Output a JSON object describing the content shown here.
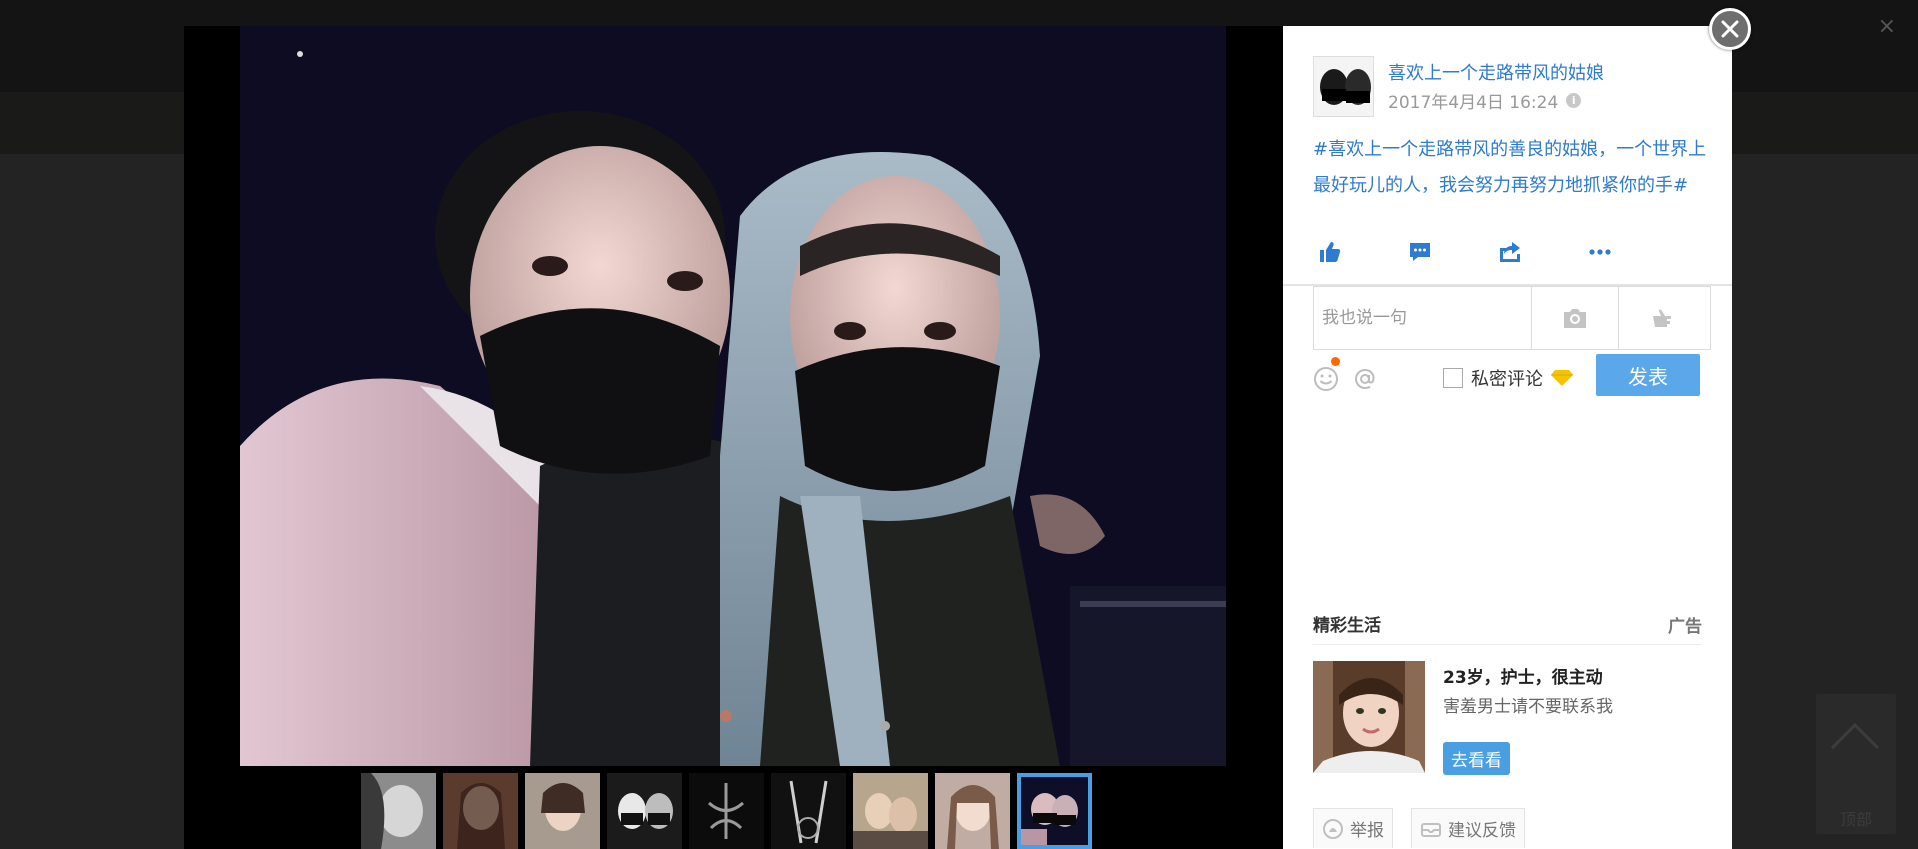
{
  "background": {
    "back_to_top_label": "顶部"
  },
  "post": {
    "author": "喜欢上一个走路带风的姑娘",
    "time": "2017年4月4日 16:24",
    "text": "#喜欢上一个走路带风的善良的姑娘，一个世界上最好玩儿的人，我会努力再努力地抓紧你的手#"
  },
  "actions": [
    {
      "name": "like",
      "icon": "thumbs-up-icon"
    },
    {
      "name": "comment",
      "icon": "comment-icon"
    },
    {
      "name": "share",
      "icon": "share-icon"
    },
    {
      "name": "more",
      "icon": "more-icon"
    }
  ],
  "comment": {
    "placeholder": "我也说一句",
    "private_label": "私密评论",
    "publish_label": "发表"
  },
  "ad": {
    "section_title": "精彩生活",
    "label": "广告",
    "headline": "23岁，护士，很主动",
    "subtitle": "害羞男士请不要联系我",
    "cta": "去看看"
  },
  "footer": {
    "report": "举报",
    "feedback": "建议反馈"
  },
  "thumbnails": [
    {
      "name": "thumb-1",
      "active": false
    },
    {
      "name": "thumb-2",
      "active": false
    },
    {
      "name": "thumb-3",
      "active": false
    },
    {
      "name": "thumb-4",
      "active": false
    },
    {
      "name": "thumb-5",
      "active": false
    },
    {
      "name": "thumb-6",
      "active": false
    },
    {
      "name": "thumb-7",
      "active": false
    },
    {
      "name": "thumb-8",
      "active": false
    },
    {
      "name": "thumb-9",
      "active": true
    }
  ],
  "colors": {
    "accent": "#2e7bcf",
    "button": "#5aa7ea",
    "active_thumb_border": "#4a9fe3"
  }
}
